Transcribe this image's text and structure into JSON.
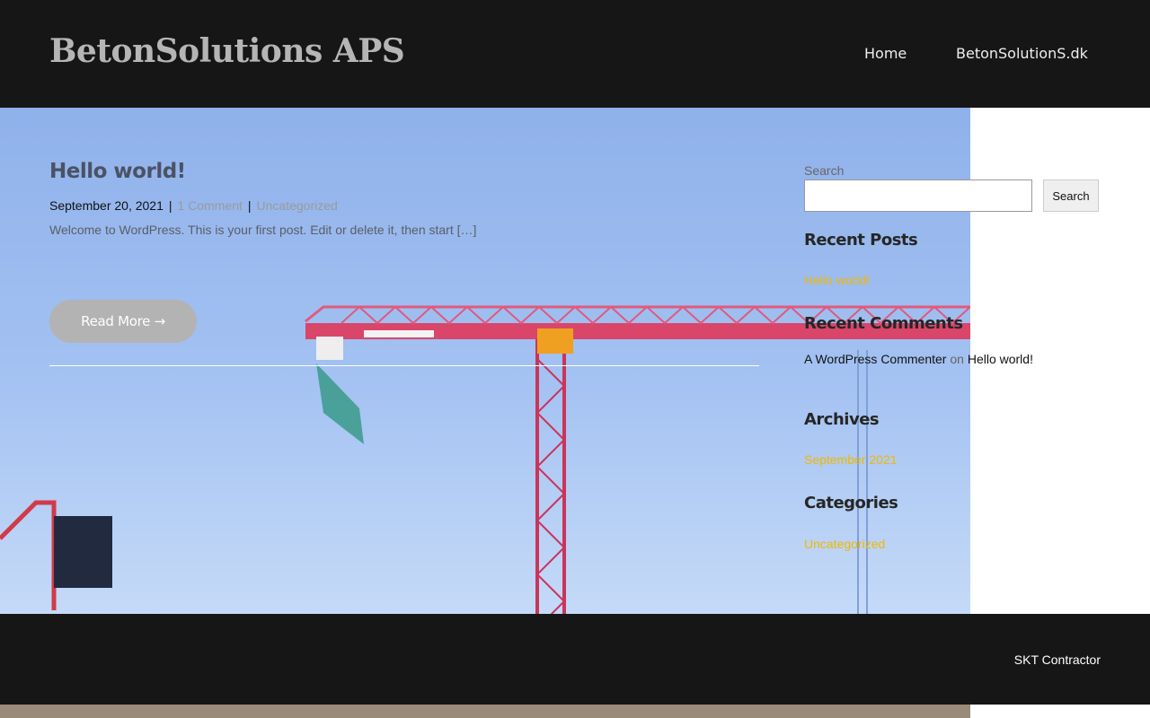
{
  "header": {
    "site_title": "BetonSolutions APS",
    "nav": [
      {
        "label": "Home"
      },
      {
        "label": "BetonSolutionS.dk"
      }
    ]
  },
  "post": {
    "title": "Hello world!",
    "date": "September 20, 2021",
    "separator": "|",
    "comments": "1 Comment",
    "category": "Uncategorized",
    "excerpt": "Welcome to WordPress. This is your first post. Edit or delete it, then start […]",
    "read_more": "Read More →"
  },
  "sidebar": {
    "search_label": "Search",
    "search_value": "",
    "search_button": "Search",
    "recent_posts_title": "Recent Posts",
    "recent_posts": [
      {
        "label": "Hello world!"
      }
    ],
    "recent_comments_title": "Recent Comments",
    "recent_comment": {
      "author": "A WordPress Commenter",
      "on": "on",
      "post": "Hello world!"
    },
    "archives_title": "Archives",
    "archives": [
      {
        "label": "September 2021"
      }
    ],
    "categories_title": "Categories",
    "categories": [
      {
        "label": "Uncategorized"
      }
    ]
  },
  "footer": {
    "text": "SKT Contractor"
  },
  "colors": {
    "header_bg": "#161616",
    "link_accent": "#f0b800",
    "button_gray": "#b3b3b3"
  }
}
